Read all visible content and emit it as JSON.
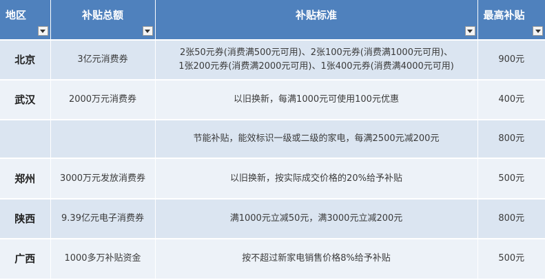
{
  "table": {
    "headers": {
      "region": "地区",
      "total": "补贴总额",
      "standard": "补贴标准",
      "max": "最高补贴"
    },
    "rows": [
      {
        "region": "北京",
        "total": "3亿元消费券",
        "standard_line1": "2张50元券(消费满500元可用)、2张100元券(消费满1000元可用)、",
        "standard_line2": "1张200元券(消费满2000元可用)、1张400元券(消费满4000元可用)",
        "max": "900元"
      },
      {
        "region": "武汉",
        "total": "2000万元消费券",
        "standard": "以旧换新，每满1000元可使用100元优惠",
        "max": "400元"
      },
      {
        "region": "",
        "total": "",
        "standard": "节能补贴，能效标识一级或二级的家电，每满2500元减200元",
        "max": "800元"
      },
      {
        "region": "郑州",
        "total": "3000万元发放消费券",
        "standard": "以旧换新，按实际成交价格的20%给予补贴",
        "max": "500元"
      },
      {
        "region": "陕西",
        "total": "9.39亿元电子消费券",
        "standard": "满1000元立减50元，满3000元立减200元",
        "max": "800元"
      },
      {
        "region": "广西",
        "total": "1000多万补贴资金",
        "standard": "按不超过新家电销售价格8%给予补贴",
        "max": "500元"
      }
    ]
  }
}
